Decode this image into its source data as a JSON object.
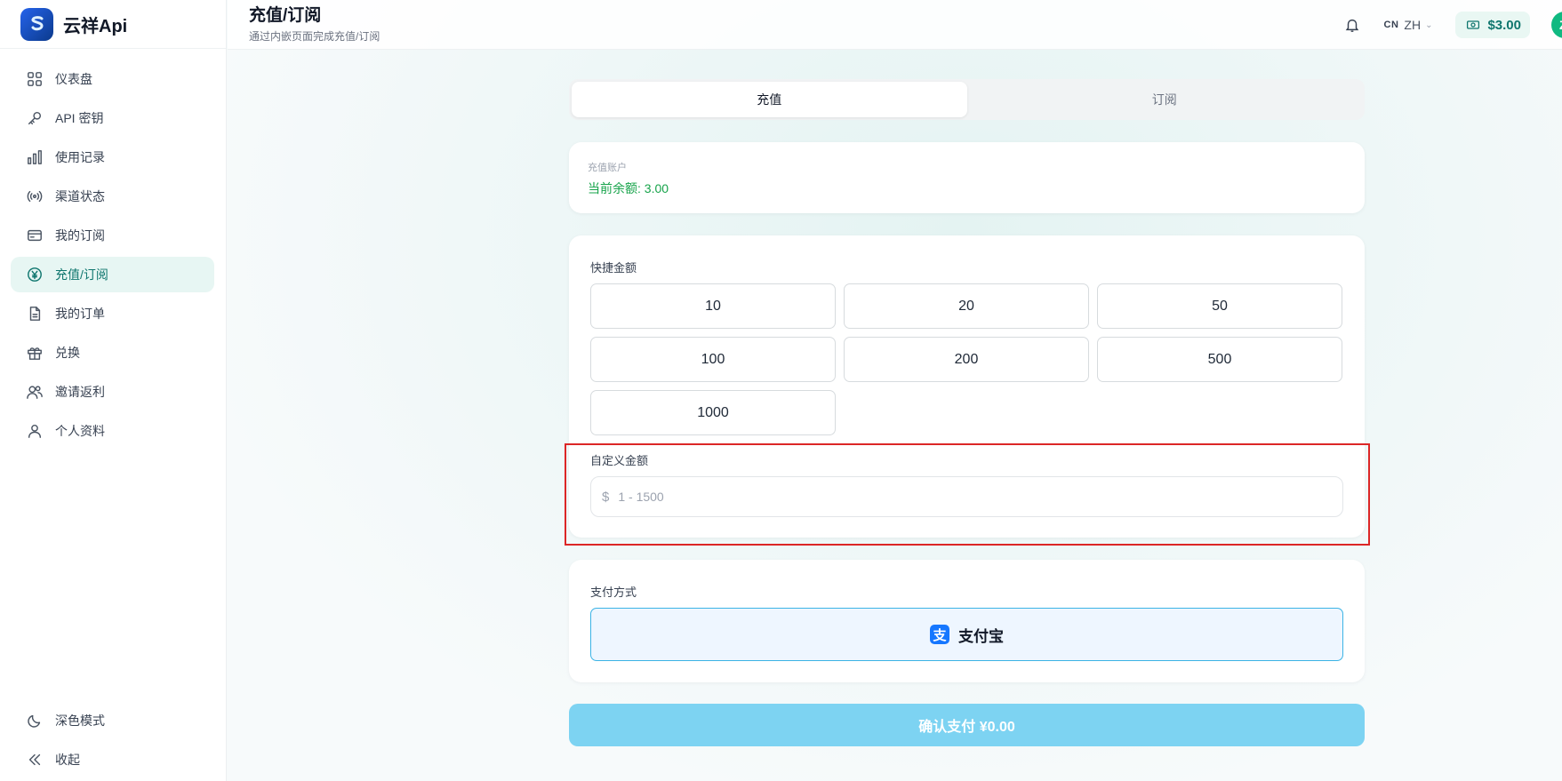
{
  "app": {
    "name": "云祥Api",
    "logo_icon": "s-logo-icon"
  },
  "sidebar": {
    "items": [
      {
        "label": "仪表盘",
        "icon": "dashboard-grid-icon"
      },
      {
        "label": "API 密钥",
        "icon": "key-icon"
      },
      {
        "label": "使用记录",
        "icon": "bar-chart-icon"
      },
      {
        "label": "渠道状态",
        "icon": "broadcast-icon"
      },
      {
        "label": "我的订阅",
        "icon": "card-icon"
      },
      {
        "label": "充值/订阅",
        "icon": "yuan-coin-icon",
        "active": true
      },
      {
        "label": "我的订单",
        "icon": "document-icon"
      },
      {
        "label": "兑换",
        "icon": "gift-icon"
      },
      {
        "label": "邀请返利",
        "icon": "users-icon"
      },
      {
        "label": "个人资料",
        "icon": "user-icon"
      }
    ],
    "bottom": [
      {
        "label": "深色模式",
        "icon": "moon-icon"
      },
      {
        "label": "收起",
        "icon": "double-chevron-left-icon"
      }
    ]
  },
  "header": {
    "title": "充值/订阅",
    "subtitle": "通过内嵌页面完成充值/订阅",
    "lang_flag": "CN",
    "lang_code": "ZH",
    "balance": "$3.00",
    "avatar_initial": "Z"
  },
  "tabs": [
    {
      "label": "充值",
      "active": true
    },
    {
      "label": "订阅",
      "active": false
    }
  ],
  "account": {
    "label": "充值账户",
    "balance_text": "当前余额: 3.00"
  },
  "amounts": {
    "label": "快捷金额",
    "options": [
      "10",
      "20",
      "50",
      "100",
      "200",
      "500",
      "1000"
    ],
    "custom_label": "自定义金额",
    "custom_prefix": "$",
    "custom_placeholder": "1 - 1500",
    "custom_value": ""
  },
  "payment": {
    "label": "支付方式",
    "method": "支付宝",
    "method_icon": "alipay-icon",
    "accent": "#1677ff"
  },
  "confirm_label": "确认支付 ¥0.00",
  "colors": {
    "primary": "#0f766e",
    "balance_green": "#16a34a",
    "confirm_bg": "#7dd3f2",
    "highlight": "#dc2626"
  }
}
